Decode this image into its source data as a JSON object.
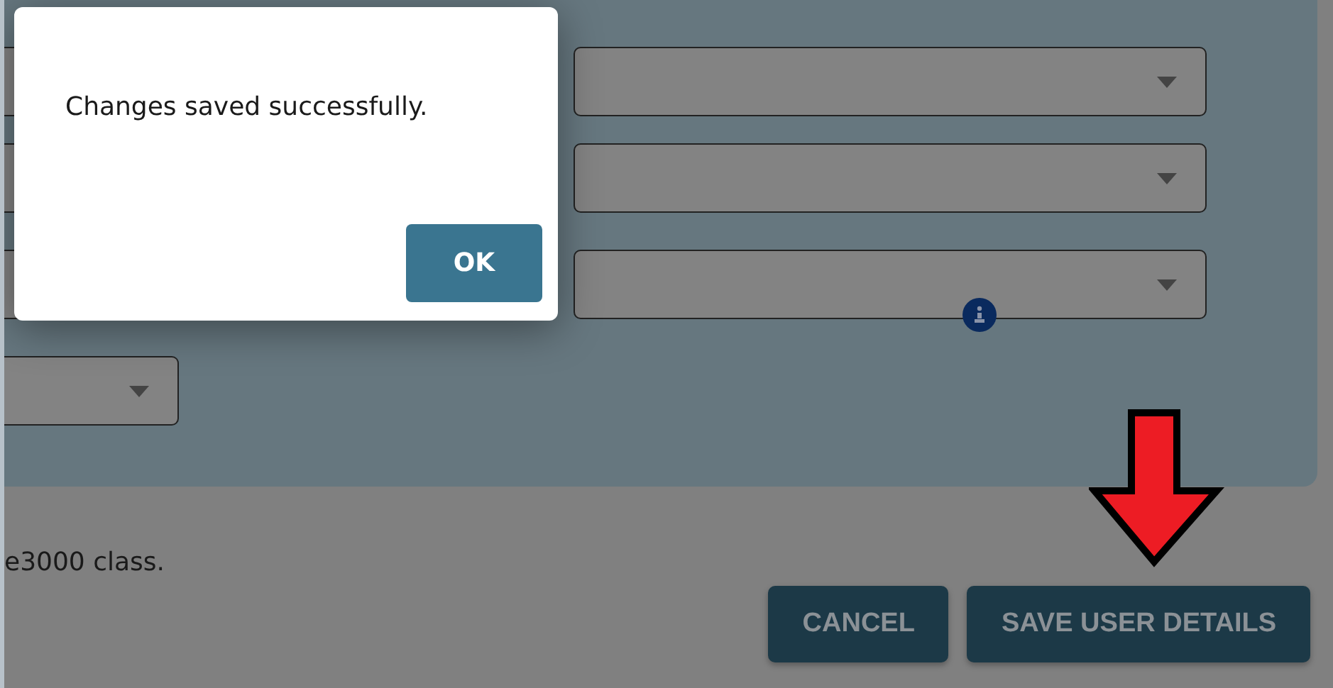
{
  "dialog": {
    "message": "Changes saved successfully.",
    "button": "OK"
  },
  "note": "e3000 class.",
  "buttons": [
    "CANCEL",
    "SAVE USER DETAILS"
  ]
}
